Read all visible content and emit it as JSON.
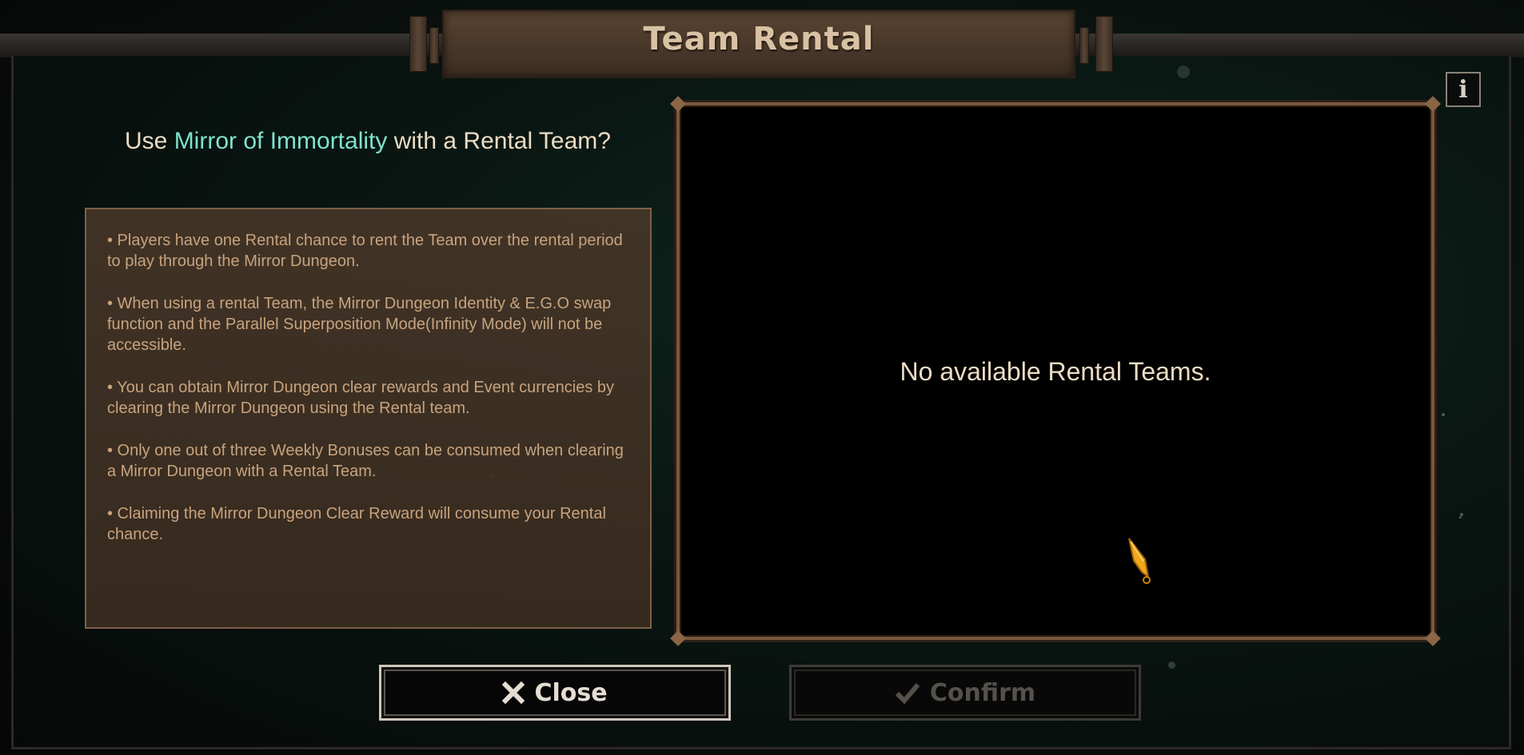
{
  "window": {
    "title": "Team Rental",
    "info_icon": "info-icon"
  },
  "prompt": {
    "prefix": "Use ",
    "highlight": "Mirror of Immortality",
    "suffix": " with a Rental Team?",
    "highlight_color": "#7fe3cc"
  },
  "rules": [
    "• Players have one Rental chance to rent the Team over the rental period to play through the Mirror Dungeon.",
    "• When using a rental Team, the Mirror Dungeon Identity & E.G.O swap function and the Parallel Superposition Mode(Infinity Mode) will not be accessible.",
    "• You can obtain Mirror Dungeon clear rewards and Event currencies by clearing the Mirror Dungeon using the Rental team.",
    "• Only one out of three Weekly Bonuses can be consumed when clearing a Mirror Dungeon with a Rental Team.",
    "• Claiming the Mirror Dungeon Clear Reward will consume your Rental chance."
  ],
  "teams": {
    "empty_message": "No available Rental Teams."
  },
  "buttons": {
    "close_label": "Close",
    "close_icon": "x-icon",
    "confirm_label": "Confirm",
    "confirm_icon": "checkmark-icon",
    "confirm_enabled": false
  },
  "colors": {
    "accent": "#7fe3cc",
    "panel_border": "#7a583c",
    "text": "#ecdcc4",
    "rule_text": "#c8a37e"
  }
}
